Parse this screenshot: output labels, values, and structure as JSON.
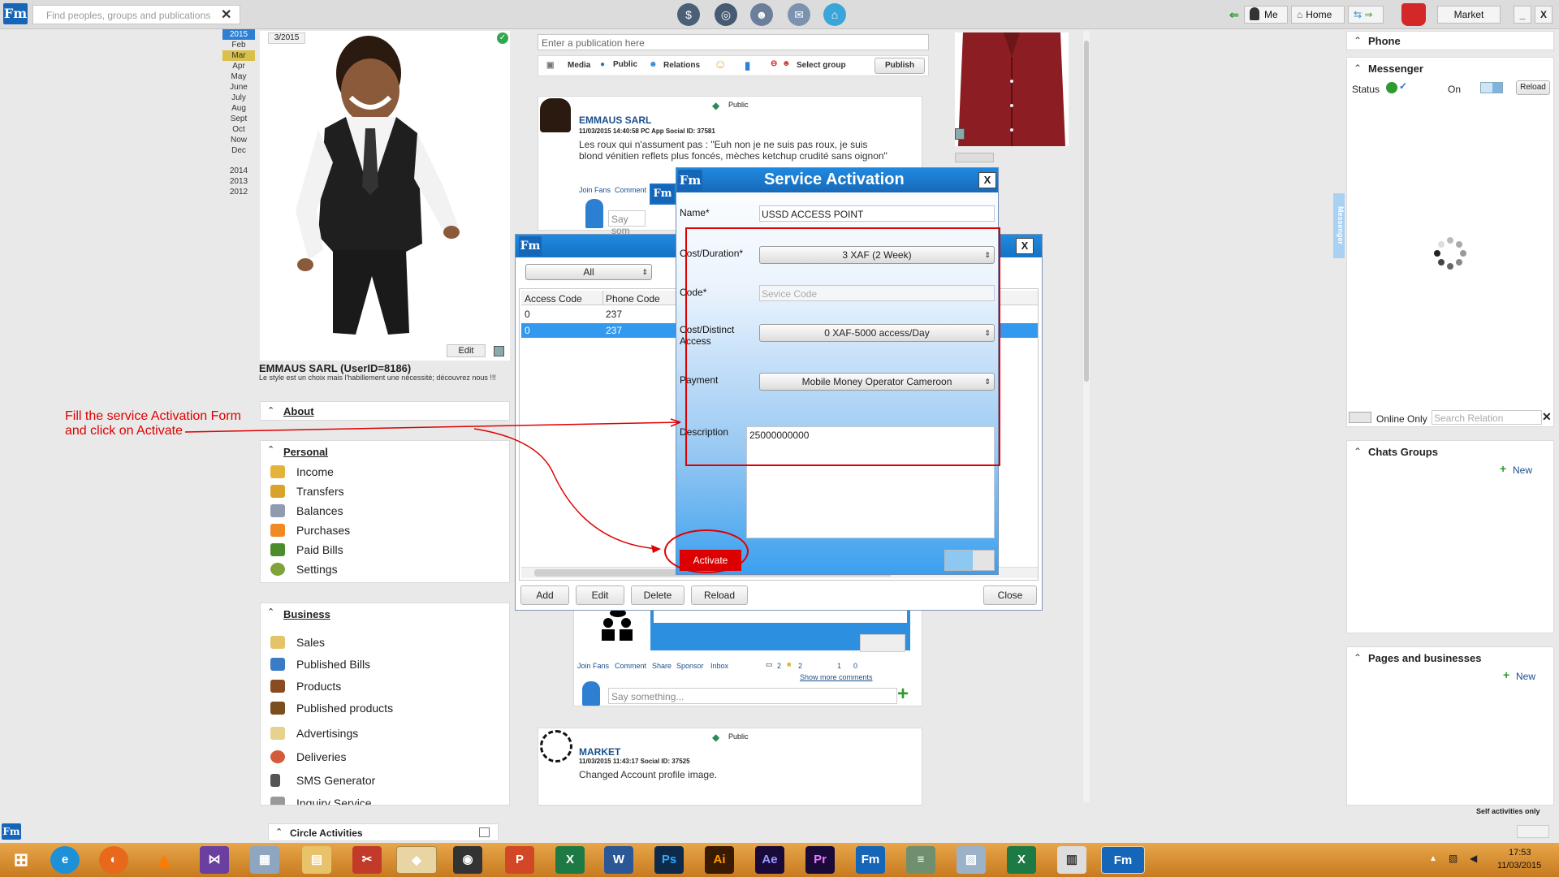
{
  "topbar": {
    "search_placeholder": "Find peoples, groups and publications",
    "me_label": "Me",
    "home_label": "Home",
    "market_label": "Market"
  },
  "dates": {
    "current_badge": "3/2015",
    "years_top": "2015",
    "months": [
      "Feb",
      "Mar",
      "Apr",
      "May",
      "June",
      "July",
      "Aug",
      "Sept",
      "Oct",
      "Now",
      "Dec"
    ],
    "years": [
      "2014",
      "2013",
      "2012"
    ]
  },
  "profile": {
    "name": "EMMAUS SARL (UserID=8186)",
    "slogan": "Le style est un choix mais l'habillement une nécessité; découvrez nous !!!",
    "edit_label": "Edit"
  },
  "about": {
    "label": "About"
  },
  "personal": {
    "label": "Personal",
    "items": [
      "Income",
      "Transfers",
      "Balances",
      "Purchases",
      "Paid Bills",
      "Settings"
    ]
  },
  "business": {
    "label": "Business",
    "items": [
      "Sales",
      "Published Bills",
      "Products",
      "Published products",
      "Advertisings",
      "Deliveries",
      "SMS Generator",
      "Inquiry Service"
    ]
  },
  "circle": {
    "label": "Circle Activities"
  },
  "publish": {
    "placeholder": "Enter a publication here",
    "media": "Media",
    "public": "Public",
    "relations": "Relations",
    "select_group": "Select group",
    "publish_btn": "Publish"
  },
  "post1": {
    "visibility": "Public",
    "author": "EMMAUS SARL",
    "meta": "11/03/2015 14:40:58  PC App  Social ID: 37581",
    "text": "Les roux qui n'assument pas : \"Euh non je ne suis pas roux, je suis blond vénitien reflets plus foncés, mèches ketchup crudité sans oignon\"",
    "join_fans": "Join Fans",
    "comment": "Comment",
    "say_placeholder": "Say som"
  },
  "post2": {
    "join_fans": "Join Fans",
    "comment": "Comment",
    "share": "Share",
    "sponsor": "Sponsor",
    "inbox": "Inbox",
    "count1": "2",
    "count2": "2",
    "count3": "1",
    "count4": "0",
    "show_more": "Show more comments",
    "say_placeholder": "Say something..."
  },
  "post3": {
    "visibility": "Public",
    "author": "MARKET",
    "meta": "11/03/2015 11:43:17  Social ID: 37525",
    "text": "Changed Account profile image."
  },
  "access_dialog": {
    "filter": "All",
    "col_access": "Access Code",
    "col_phone": "Phone Code",
    "rows": [
      {
        "access": "0",
        "phone": "237"
      },
      {
        "access": "0",
        "phone": "237"
      }
    ],
    "btn_add": "Add",
    "btn_edit": "Edit",
    "btn_delete": "Delete",
    "btn_reload": "Reload",
    "btn_close": "Close"
  },
  "service_activation": {
    "title": "Service Activation",
    "close": "X",
    "name_label": "Name*",
    "name_value": "USSD ACCESS POINT",
    "cost_duration_label": "Cost/Duration*",
    "cost_duration_value": "3 XAF (2 Week)",
    "code_label": "Code*",
    "code_placeholder": "Sevice Code",
    "cost_distinct_label": "Cost/Distinct Access",
    "cost_distinct_value": "0 XAF-5000 access/Day",
    "payment_label": "Payment",
    "payment_value": "Mobile Money Operator Cameroon",
    "description_label": "Description",
    "description_value": "25000000000",
    "activate": "Activate"
  },
  "annotation": {
    "line1": "Fill the service Activation Form",
    "line2": "and click on Activate"
  },
  "right": {
    "phone": "Phone",
    "messenger": "Messenger",
    "status": "Status",
    "on": "On",
    "reload": "Reload",
    "online_only": "Online Only",
    "search_relation": "Search Relation",
    "chats_groups": "Chats Groups",
    "new": "New",
    "pages": "Pages and businesses",
    "messenger_tab": "Messenger",
    "self_activities": "Self activities only"
  },
  "taskbar": {
    "time": "17:53",
    "date": "11/03/2015"
  }
}
